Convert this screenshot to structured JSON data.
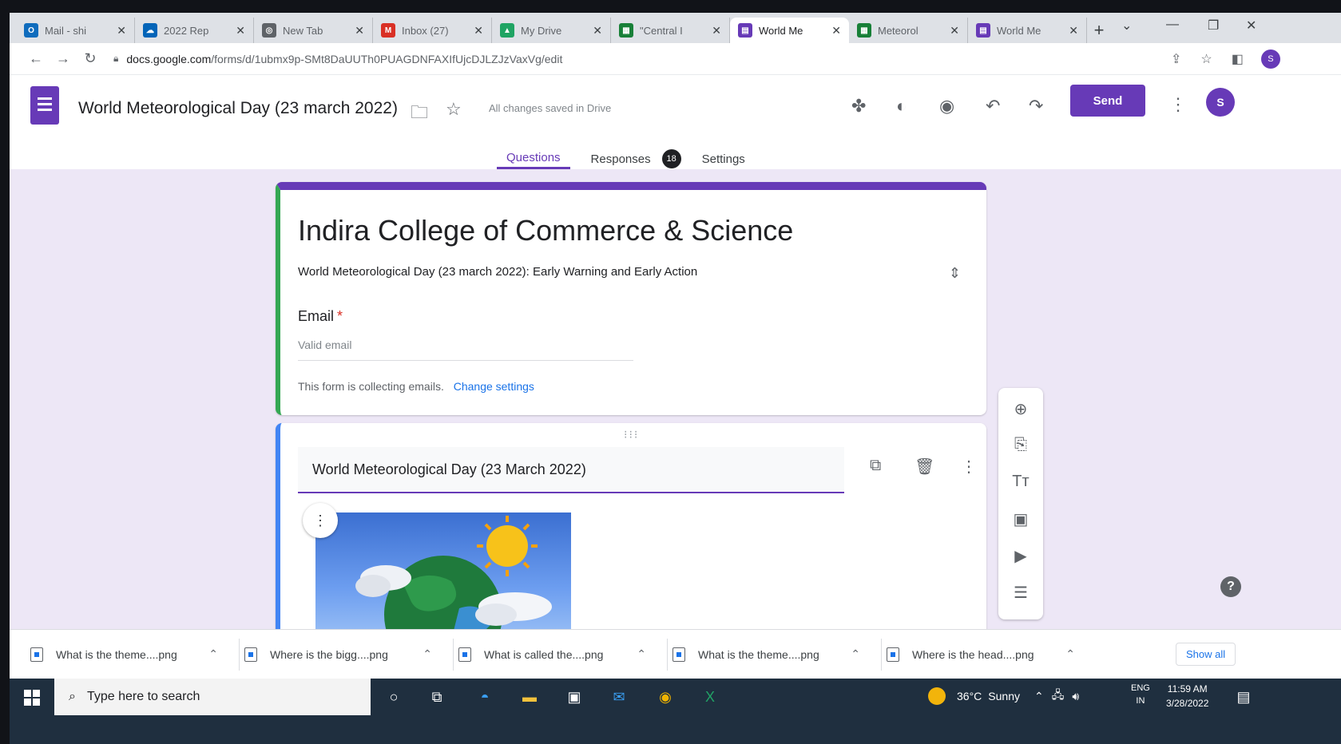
{
  "browser": {
    "tabs": [
      {
        "label": "Mail - shi",
        "icon": "outlook-icon",
        "color": "#0f6cbd"
      },
      {
        "label": "2022 Rep",
        "icon": "onedrive-icon",
        "color": "#0364b8"
      },
      {
        "label": "New Tab",
        "icon": "chrome-icon",
        "color": "#5f6368"
      },
      {
        "label": "Inbox (27)",
        "icon": "gmail-icon",
        "color": "#d93025"
      },
      {
        "label": "My Drive",
        "icon": "drive-icon",
        "color": "#1fa463"
      },
      {
        "label": "\"Central I",
        "icon": "sheets-icon",
        "color": "#188038"
      },
      {
        "label": "World Me",
        "icon": "forms-icon",
        "color": "#673ab7"
      },
      {
        "label": "Meteorol",
        "icon": "sheets-icon",
        "color": "#188038"
      },
      {
        "label": "World Me",
        "icon": "forms-icon",
        "color": "#673ab7"
      }
    ],
    "active_tab_index": 6,
    "url_host": "docs.google.com",
    "url_path": "/forms/d/1ubmx9p-SMt8DaUUTh0PUAGDNFAXIfUjcDJLZJzVaxVg/edit",
    "profile_initial": "S"
  },
  "header": {
    "doc_title": "World Meteorological Day (23 march 2022)",
    "save_status": "All changes saved in Drive",
    "send_label": "Send",
    "avatar_initial": "S",
    "tabs": [
      {
        "label": "Questions",
        "active": true
      },
      {
        "label": "Responses",
        "badge": "18"
      },
      {
        "label": "Settings"
      }
    ]
  },
  "form": {
    "title": "Indira College of Commerce & Science",
    "description": "World Meteorological Day (23 march 2022): Early Warning and Early Action",
    "email_label": "Email",
    "email_required_mark": "*",
    "email_placeholder": "Valid email",
    "collect_note": "This form is collecting emails.",
    "change_settings_label": "Change settings",
    "section_question": "World Meteorological Day (23 March 2022)"
  },
  "downloads": {
    "items": [
      "What is the theme....png",
      "Where is the bigg....png",
      "What is called the....png",
      "What is the theme....png",
      "Where is the head....png"
    ],
    "show_all_label": "Show all"
  },
  "taskbar": {
    "search_placeholder": "Type here to search",
    "temperature": "36°C",
    "weather": "Sunny",
    "lang_top": "ENG",
    "lang_bottom": "IN",
    "time": "11:59 AM",
    "date": "3/28/2022"
  },
  "colors": {
    "accent": "#673ab7",
    "link": "#1a73e8",
    "canvas_bg": "#ede7f6"
  }
}
